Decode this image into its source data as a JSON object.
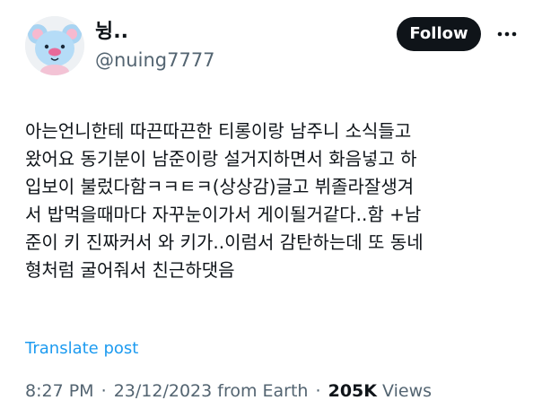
{
  "author": {
    "display_name": "뉭..",
    "handle": "@nuing7777",
    "avatar_icon": "blue-koala-character-avatar"
  },
  "actions": {
    "follow_label": "Follow",
    "more_icon": "more-horizontal-icon"
  },
  "post": {
    "lines": [
      "아는언니한테 따끈따끈한 티롱이랑 남주니 소식들고",
      "왔어요 동기분이 남준이랑 설거지하면서 화음넣고 하",
      "입보이 불렀다함ㅋㅋㅌㅋ(상상감)글고 뷔졸라잘생겨",
      "서 밥먹을때마다 자꾸눈이가서 게이될거같다..함 +남",
      "준이 키 진짜커서 와 키가..이럼서 감탄하는데 또 동네",
      "형처럼 굴어줘서 친근하댓음"
    ],
    "translate_label": "Translate post"
  },
  "meta": {
    "time": "8:27 PM",
    "separator": "·",
    "date": "23/12/2023 from Earth",
    "views_count": "205K",
    "views_label": "Views"
  },
  "colors": {
    "text": "#0f1419",
    "secondary": "#536471",
    "link": "#1d9bf0",
    "button_bg": "#0f1419"
  }
}
